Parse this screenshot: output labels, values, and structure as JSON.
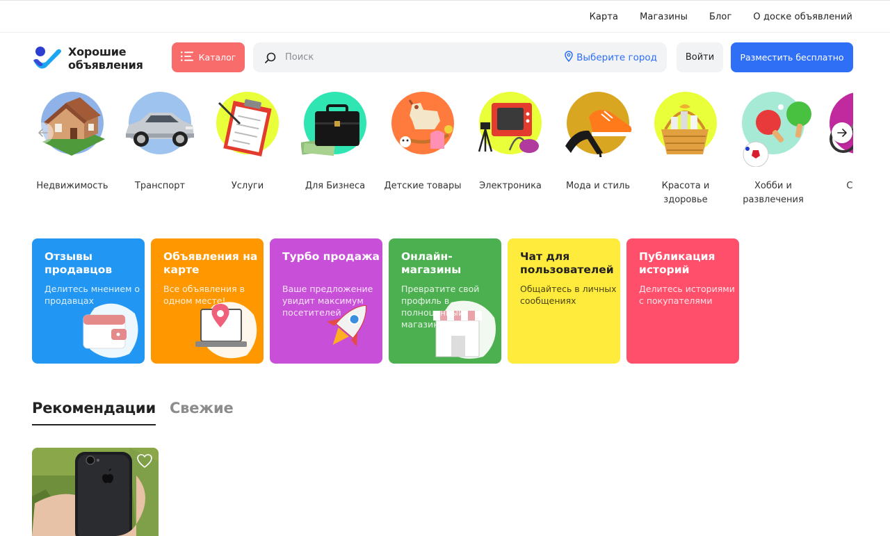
{
  "topnav": {
    "items": [
      "Карта",
      "Магазины",
      "Блог",
      "О доске объявлений"
    ]
  },
  "header": {
    "logo_line1": "Хорошие",
    "logo_line2": "объявления",
    "catalog_label": "Каталог",
    "search_placeholder": "Поиск",
    "city_label": "Выберите город",
    "login_label": "Войти",
    "post_label": "Разместить бесплатно"
  },
  "categories": [
    {
      "label": "Недвижимость",
      "circle_color": "#8fb3e8",
      "icon": "house-icon"
    },
    {
      "label": "Транспорт",
      "circle_color": "#9ec3ee",
      "icon": "car-icon"
    },
    {
      "label": "Услуги",
      "circle_color": "#e9ff3a",
      "icon": "clipboard-icon"
    },
    {
      "label": "Для Бизнеса",
      "circle_color": "#2fe6b2",
      "icon": "briefcase-icon"
    },
    {
      "label": "Детские товары",
      "circle_color": "#ff7a3d",
      "icon": "rocking-horse-icon"
    },
    {
      "label": "Электроника",
      "circle_color": "#e9ff3a",
      "icon": "tv-icon"
    },
    {
      "label": "Мода и стиль",
      "circle_color": "#d9a622",
      "icon": "shoes-icon"
    },
    {
      "label": "Красота и здоровье",
      "circle_color": "#e9ff3a",
      "icon": "gift-basket-icon"
    },
    {
      "label": "Хобби и развлечения",
      "circle_color": "#a6ead6",
      "icon": "ping-pong-icon"
    },
    {
      "label": "Спорт",
      "circle_color": "#c02a9e",
      "icon": "bicycle-icon"
    }
  ],
  "features": [
    {
      "title": "Отзывы продавцов",
      "desc": "Делитесь мнением о продавцах",
      "color": "#2196f3",
      "icon": "wallet-icon"
    },
    {
      "title": "Объявления на карте",
      "desc": "Все объявления в одном месте!",
      "color": "#ff9800",
      "icon": "map-laptop-icon"
    },
    {
      "title": "Турбо продажа",
      "desc": "Ваше предложение увидит максимум посетителей",
      "color": "#c84fd8",
      "icon": "rocket-icon"
    },
    {
      "title": "Онлайн-магазины",
      "desc": "Превратите свой профиль в полноценный магазин",
      "color": "#4caf50",
      "icon": "shop-icon"
    },
    {
      "title": "Чат для пользователей",
      "desc": "Общайтесь в личных сообщениях",
      "color": "#ffeb3b",
      "icon": "chat-icon"
    },
    {
      "title": "Публикация историй",
      "desc": "Делитесь историями с покупателями",
      "color": "#ff4f6b",
      "icon": "stories-icon"
    }
  ],
  "tabs": {
    "recommend": "Рекомендации",
    "fresh": "Свежие"
  },
  "colors": {
    "accent_blue": "#2f6ff6",
    "catalog_red": "#f86c6c",
    "city_blue": "#2b6ff7"
  }
}
